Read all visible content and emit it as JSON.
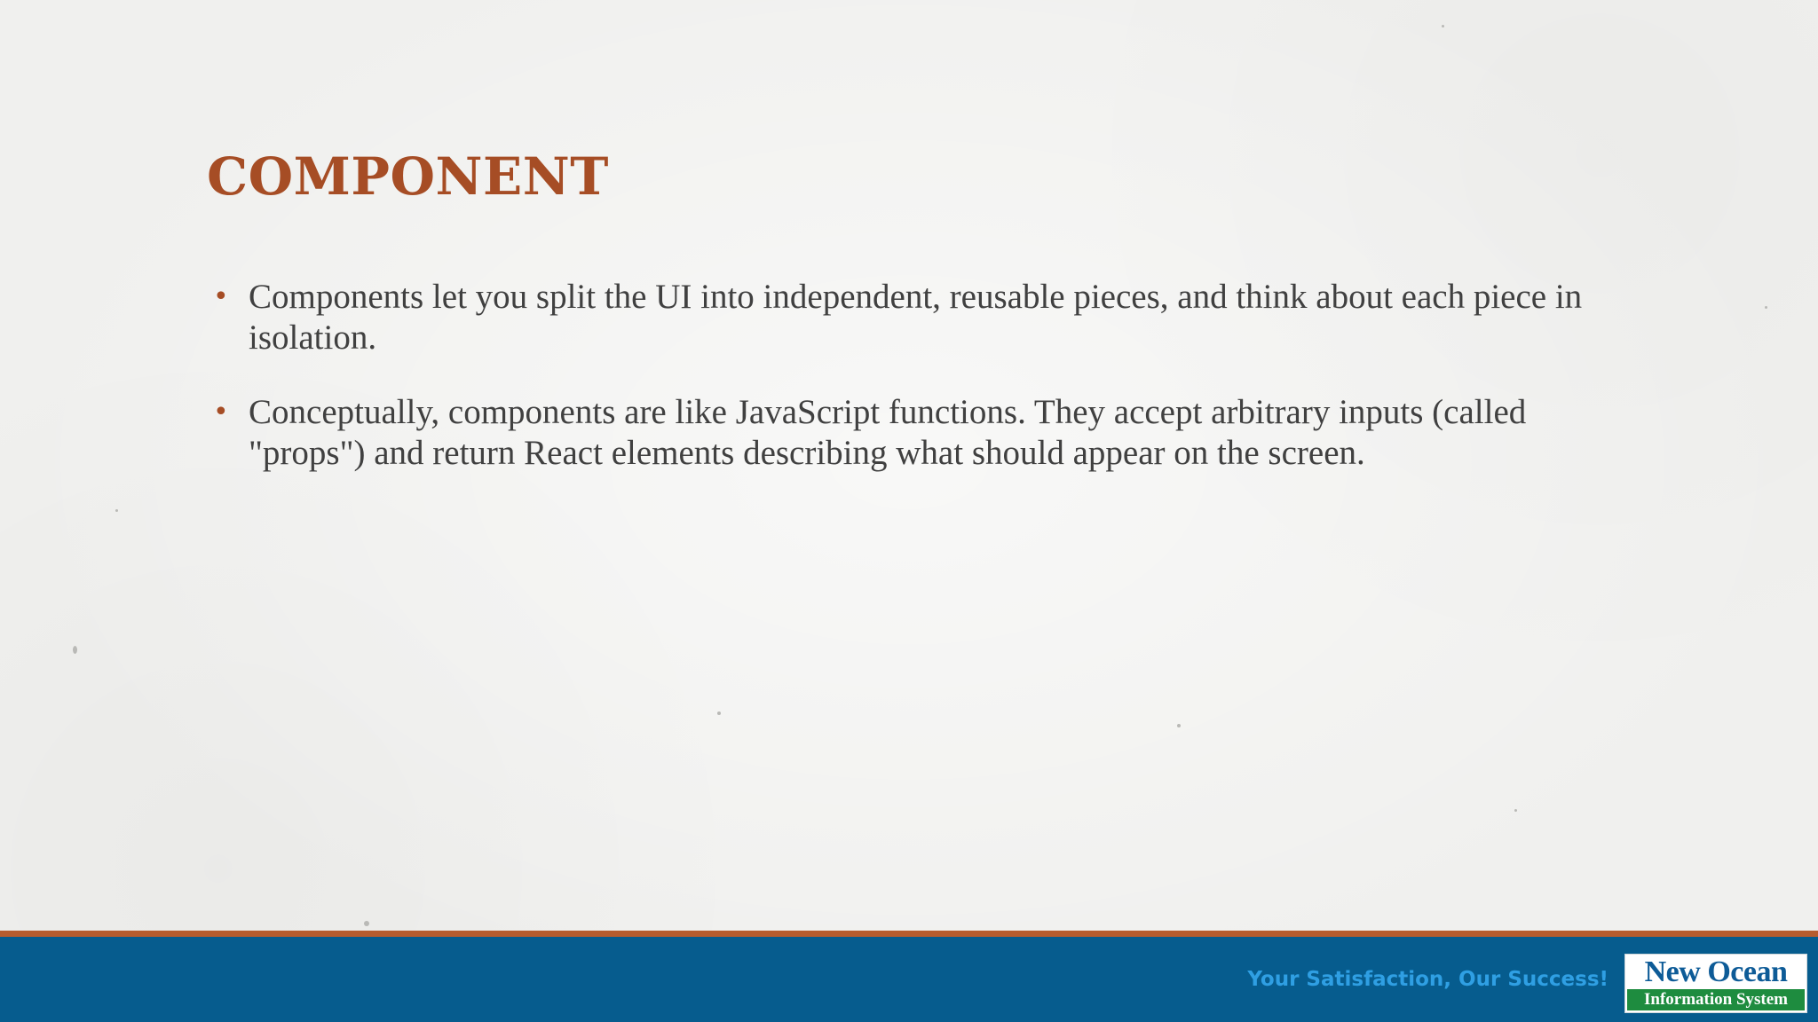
{
  "slide": {
    "title": "COMPONENT",
    "bullets": [
      "Components let you split the UI into independent, reusable pieces, and think about each piece in isolation.",
      "Conceptually, components are like JavaScript functions. They accept arbitrary inputs (called \"props\") and return React elements describing what should appear on the screen."
    ],
    "bullet_glyph": "•"
  },
  "footer": {
    "slogan": "Your Satisfaction, Our Success!",
    "logo": {
      "line1": "New Ocean",
      "line2": "Information System"
    }
  },
  "colors": {
    "title": "#a64d25",
    "body_text": "#404040",
    "footer_bar": "#065c8e",
    "footer_rule": "#b65c2e",
    "slogan": "#2f9fe3",
    "logo_blue": "#0d5b97",
    "logo_green": "#1e8c3f"
  }
}
